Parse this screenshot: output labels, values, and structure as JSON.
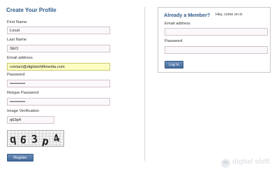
{
  "register": {
    "title": "Create Your Profile",
    "first_name_label": "First Name",
    "first_name_value": "Local",
    "last_name_label": "Last Name",
    "last_name_value": "SEO",
    "email_label": "Email address",
    "email_value": "contact@digitalshiftmedia.com",
    "password_label": "Password",
    "password_value": "•••••••••••",
    "retype_label": "Retype Password",
    "retype_value": "•••••••••••",
    "verification_label": "Image Verification",
    "verification_value": "q63p4",
    "captcha_text": "q63p4",
    "register_button": "Register"
  },
  "login": {
    "title": "Already a Member?",
    "subtitle": "Hey, come on in",
    "email_label": "Email address",
    "password_label": "Password",
    "login_button": "Log In"
  },
  "brand": {
    "mark": "ds",
    "name": "digital shift"
  },
  "colors": {
    "accent": "#2e5b8a",
    "button": "#4f75a6",
    "highlight_field": "#fdfdc4"
  }
}
